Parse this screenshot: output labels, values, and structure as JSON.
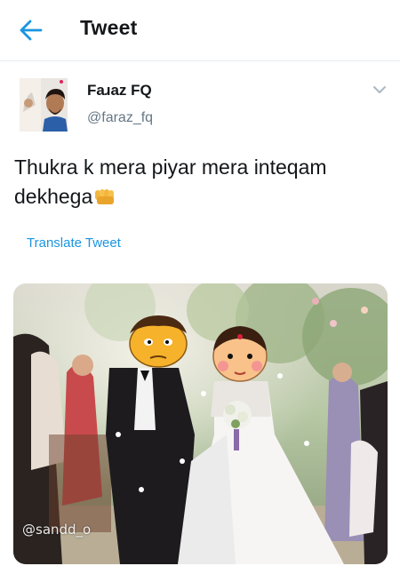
{
  "header": {
    "title": "Tweet",
    "back_icon": "arrow-left-icon"
  },
  "tweet": {
    "author": {
      "display_name": "Faɹaz FQ",
      "handle": "@faraz_fq"
    },
    "text": "Thukra k mera piyar mera inteqam dekhega",
    "emoji": "fist-icon",
    "translate_label": "Translate Tweet",
    "media": {
      "watermark": "@sandd_o"
    }
  },
  "colors": {
    "accent": "#1b95e0",
    "secondary_text": "#657786",
    "primary_text": "#14171a"
  }
}
